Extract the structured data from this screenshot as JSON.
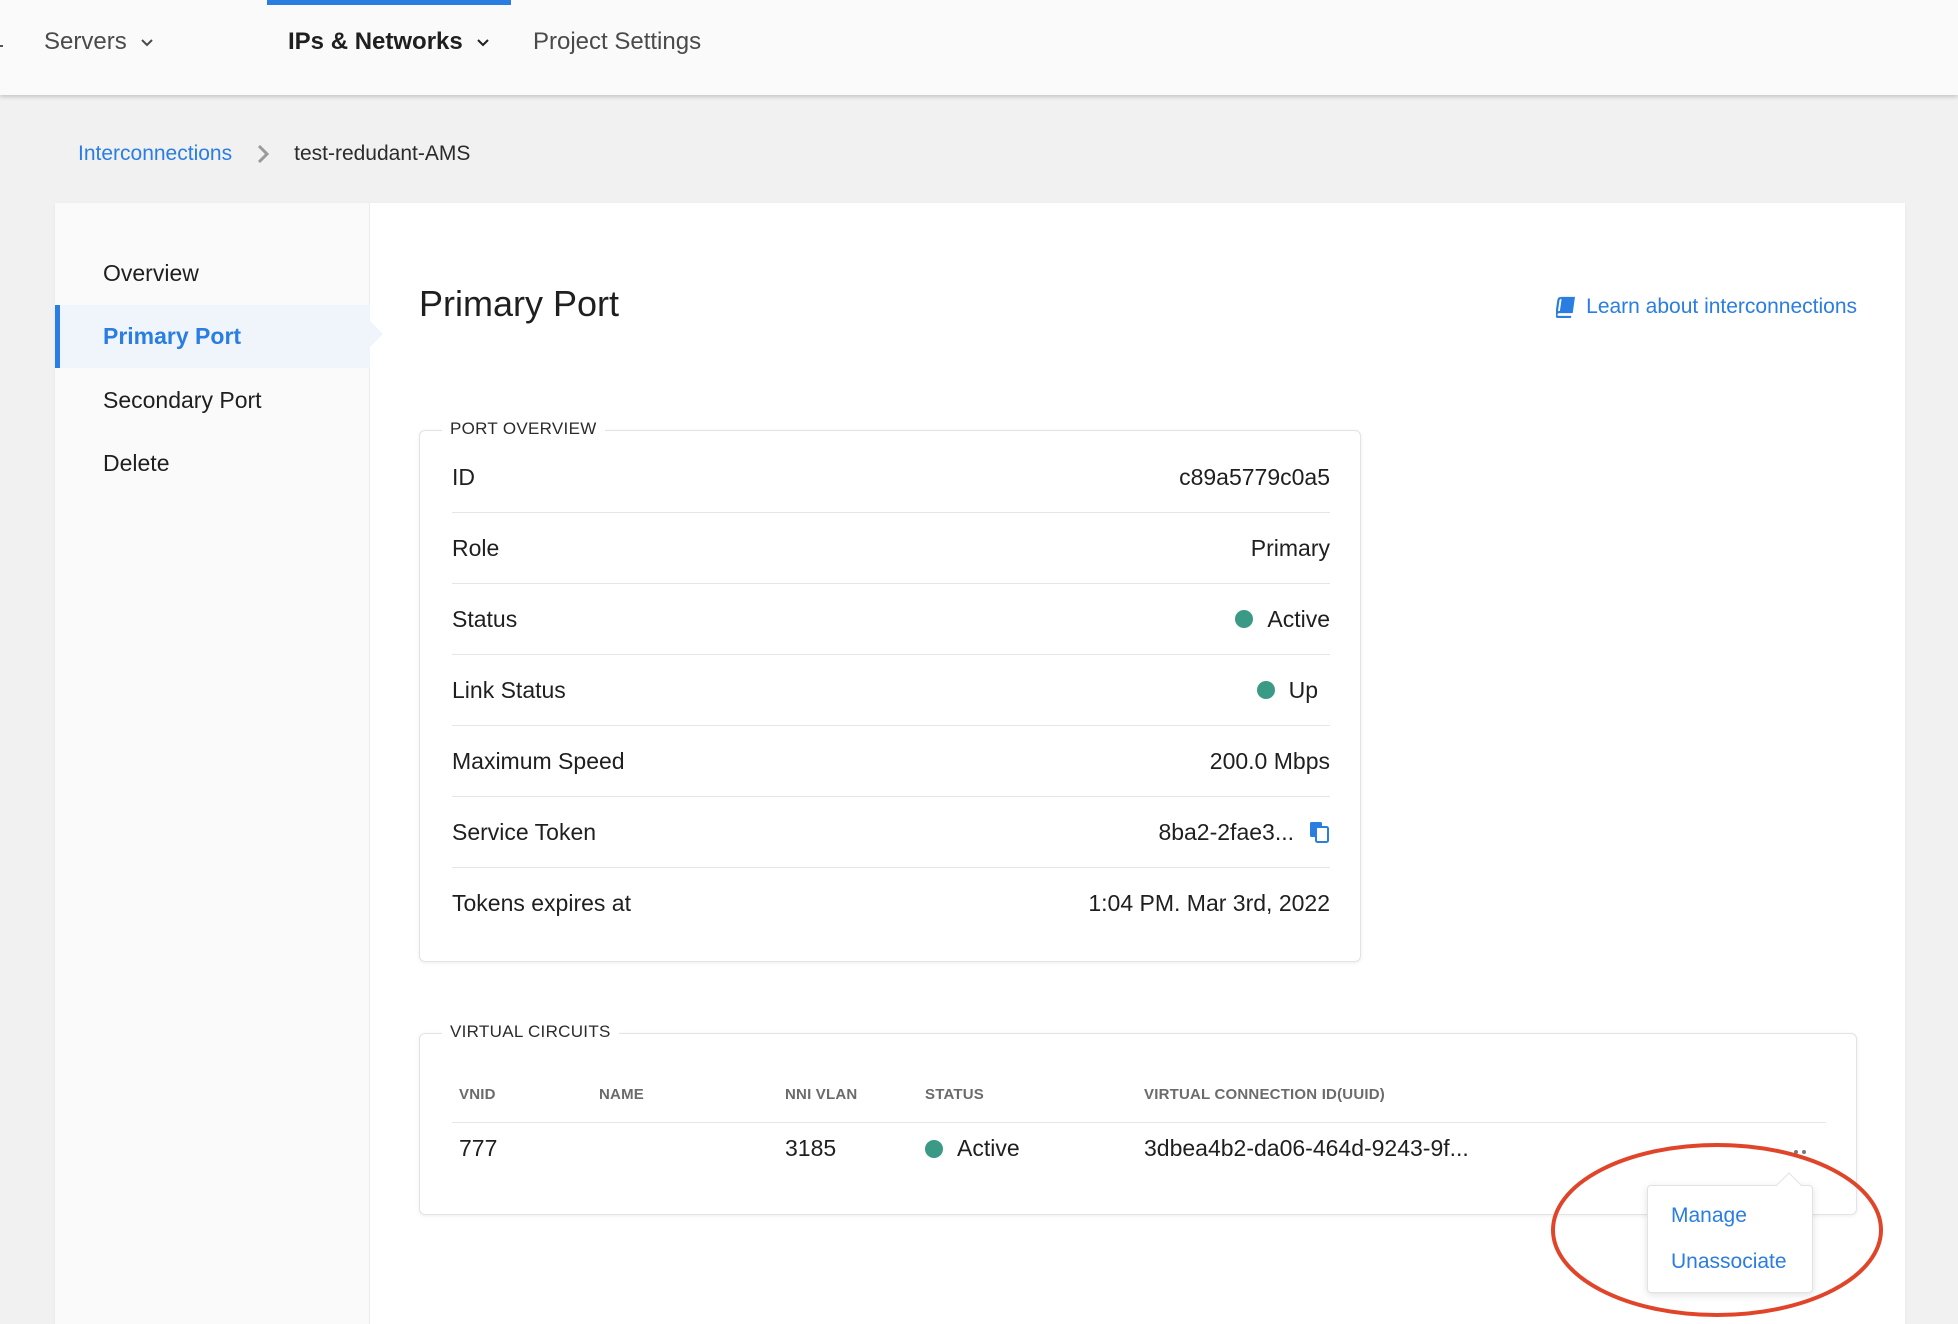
{
  "nav": {
    "items": [
      {
        "label": "Servers"
      },
      {
        "label": "IPs & Networks"
      },
      {
        "label": "Project Settings"
      }
    ]
  },
  "breadcrumb": {
    "parent": "Interconnections",
    "current": "test-redudant-AMS"
  },
  "sidebar": {
    "items": [
      {
        "label": "Overview"
      },
      {
        "label": "Primary Port"
      },
      {
        "label": "Secondary Port"
      },
      {
        "label": "Delete"
      }
    ],
    "active": "Primary Port"
  },
  "page": {
    "title": "Primary Port",
    "learn_link": "Learn about interconnections"
  },
  "port_overview": {
    "legend": "PORT OVERVIEW",
    "rows": [
      {
        "label": "ID",
        "value": "c89a5779c0a5"
      },
      {
        "label": "Role",
        "value": "Primary"
      },
      {
        "label": "Status",
        "value": "Active"
      },
      {
        "label": "Link Status",
        "value": "Up"
      },
      {
        "label": "Maximum Speed",
        "value": "200.0 Mbps"
      },
      {
        "label": "Service Token",
        "value": "8ba2-2fae3..."
      },
      {
        "label": "Tokens expires at",
        "value": "1:04 PM. Mar 3rd, 2022"
      }
    ]
  },
  "virtual_circuits": {
    "legend": "VIRTUAL CIRCUITS",
    "columns": [
      "VNID",
      "NAME",
      "NNI VLAN",
      "STATUS",
      "VIRTUAL CONNECTION ID(UUID)"
    ],
    "rows": [
      {
        "vnid": "777",
        "name": "",
        "nni_vlan": "3185",
        "status": "Active",
        "uuid": "3dbea4b2-da06-464d-9243-9f..."
      }
    ]
  },
  "row_menu": {
    "items": [
      "Manage",
      "Unassociate"
    ]
  },
  "colors": {
    "accent": "#2a7de1",
    "status_active": "#3a9a86",
    "annotation": "#e0452a"
  }
}
